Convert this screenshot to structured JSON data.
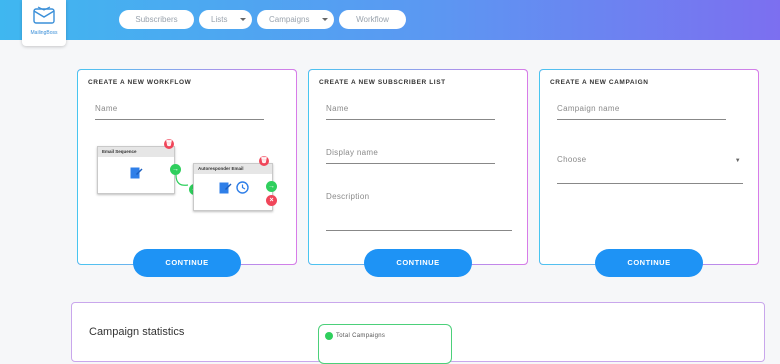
{
  "header": {
    "logo_text": "MailingBoss",
    "nav": [
      {
        "label": "Subscribers"
      },
      {
        "label": "Lists"
      },
      {
        "label": "Campaigns"
      },
      {
        "label": "Workflow"
      }
    ]
  },
  "cards": {
    "workflow": {
      "title": "CREATE A NEW WORKFLOW",
      "name_placeholder": "Name",
      "diagram": {
        "box1_title": "Email Sequence",
        "box2_title": "Autoresponder Email"
      },
      "button": "CONTINUE"
    },
    "list": {
      "title": "CREATE A NEW SUBSCRIBER LIST",
      "name_placeholder": "Name",
      "display_placeholder": "Display name",
      "description_placeholder": "Description",
      "button": "CONTINUE"
    },
    "campaign": {
      "title": "CREATE A NEW CAMPAIGN",
      "name_placeholder": "Campaign name",
      "choose_label": "Choose",
      "button": "CONTINUE"
    }
  },
  "stats": {
    "title": "Campaign statistics",
    "total_campaigns_label": "Total Campaigns"
  },
  "colors": {
    "accent": "#1e93f5",
    "success": "#2fcf5d",
    "danger": "#f0465a"
  }
}
